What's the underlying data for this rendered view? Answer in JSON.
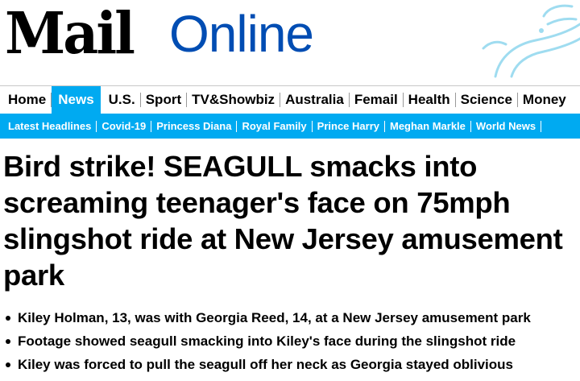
{
  "masthead": {
    "brand_main": "Mail",
    "brand_secondary": "Online"
  },
  "nav_primary": {
    "items": [
      {
        "label": "Home",
        "active": false
      },
      {
        "label": "News",
        "active": true
      },
      {
        "label": "U.S.",
        "active": false
      },
      {
        "label": "Sport",
        "active": false
      },
      {
        "label": "TV&Showbiz",
        "active": false
      },
      {
        "label": "Australia",
        "active": false
      },
      {
        "label": "Femail",
        "active": false
      },
      {
        "label": "Health",
        "active": false
      },
      {
        "label": "Science",
        "active": false
      },
      {
        "label": "Money",
        "active": false
      }
    ]
  },
  "nav_secondary": {
    "items": [
      {
        "label": "Latest Headlines"
      },
      {
        "label": "Covid-19"
      },
      {
        "label": "Princess Diana"
      },
      {
        "label": "Royal Family"
      },
      {
        "label": "Prince Harry"
      },
      {
        "label": "Meghan Markle"
      },
      {
        "label": "World News"
      }
    ]
  },
  "article": {
    "headline": "Bird strike! SEAGULL smacks into screaming teenager's face on 75mph slingshot ride at New Jersey amusement park",
    "bullets": [
      "Kiley Holman, 13, was with Georgia Reed, 14, at a New Jersey amusement park",
      "Footage showed seagull smacking into Kiley's face during the slingshot ride",
      "Kiley was forced to pull the seagull off her neck as Georgia stayed oblivious"
    ]
  },
  "colors": {
    "accent": "#00aaf1",
    "brand_blue": "#004db3",
    "text": "#000000"
  }
}
